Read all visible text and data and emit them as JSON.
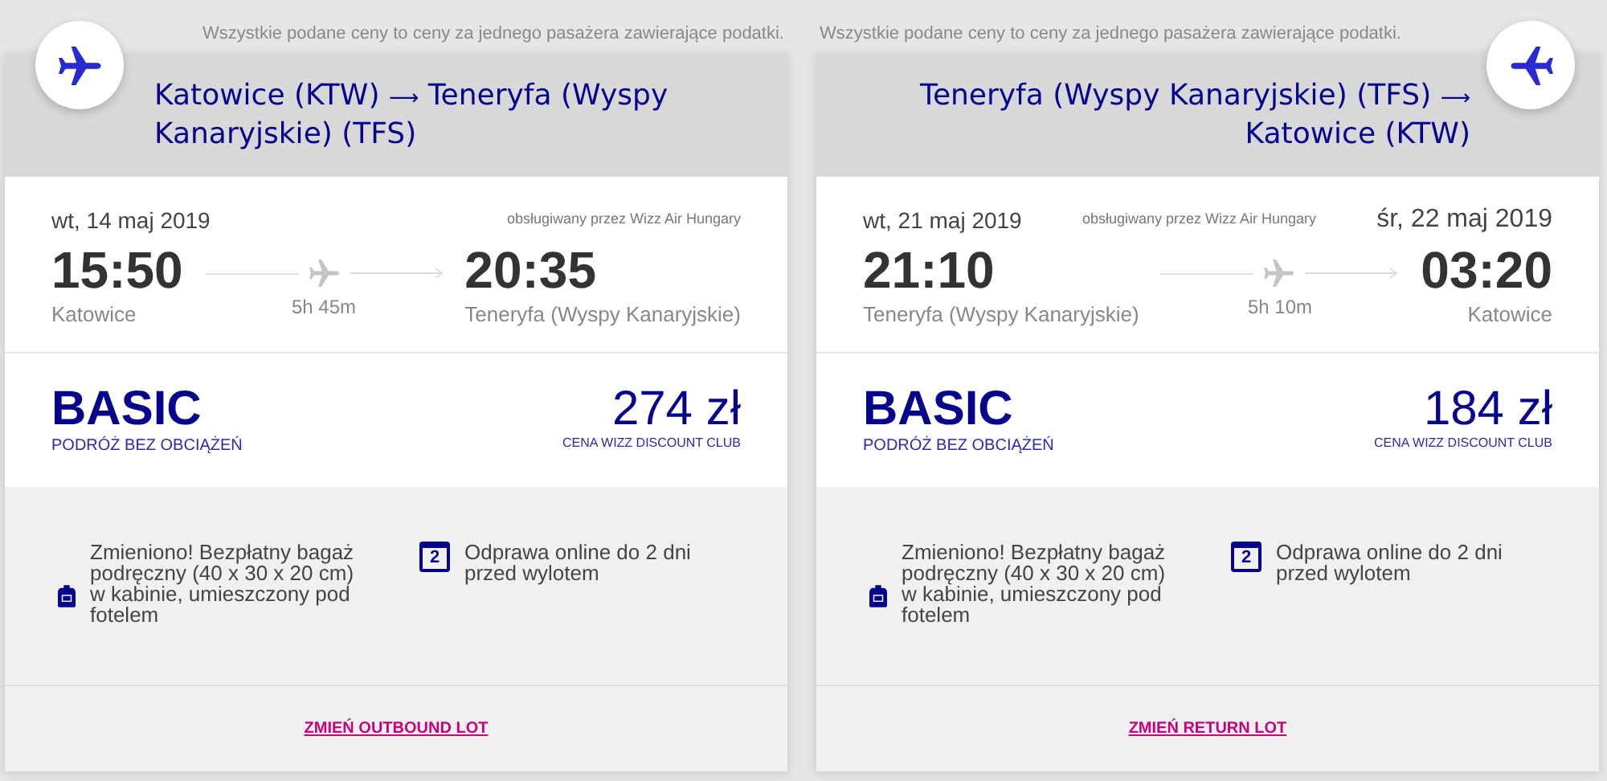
{
  "cards": [
    {
      "kind": "outbound",
      "note": "Wszystkie podane ceny to ceny za jednego pasażera zawierające podatki.",
      "route_from": "Katowice (KTW)",
      "arrow": "⟶",
      "route_to": "Teneryfa (Wyspy Kanaryjskie) (TFS)",
      "departure_date": "wt, 14 maj 2019",
      "operator": "obsługiwany przez Wizz Air Hungary",
      "departure_time": "15:50",
      "departure_city": "Katowice",
      "duration": "5h 45m",
      "arrival_time": "20:35",
      "arrival_city": "Teneryfa (Wyspy Kanaryjskie)",
      "fare": "BASIC",
      "fare_subtitle": "PODRÓŻ BEZ OBCIĄŻEŃ",
      "price": "274 zł",
      "price_label": "CENA WIZZ DISCOUNT CLUB",
      "features": [
        {
          "kind": "bag",
          "text": "Zmieniono! Bezpłatny bagaż podręczny (40 x 30 x 20 cm) w kabinie, umieszczony pod fotelem"
        },
        {
          "kind": "calendar",
          "icon_text": "2",
          "text": "Odprawa online do 2 dni przed wylotem"
        }
      ],
      "change_link": "ZMIEŃ OUTBOUND LOT"
    },
    {
      "kind": "return",
      "note": "Wszystkie podane ceny to ceny za jednego pasażera zawierające podatki.",
      "route_from": "Teneryfa (Wyspy Kanaryjskie) (TFS)",
      "arrow": "⟶",
      "route_to": "Katowice (KTW)",
      "departure_date": "wt, 21 maj 2019",
      "operator": "obsługiwany przez Wizz Air Hungary",
      "arrival_date": "śr, 22 maj 2019",
      "departure_time": "21:10",
      "departure_city": "Teneryfa (Wyspy Kanaryjskie)",
      "duration": "5h 10m",
      "arrival_time": "03:20",
      "arrival_city": "Katowice",
      "fare": "BASIC",
      "fare_subtitle": "PODRÓŻ BEZ OBCIĄŻEŃ",
      "price": "184 zł",
      "price_label": "CENA WIZZ DISCOUNT CLUB",
      "features": [
        {
          "kind": "bag",
          "text": "Zmieniono! Bezpłatny bagaż podręczny (40 x 30 x 20 cm) w kabinie, umieszczony pod fotelem"
        },
        {
          "kind": "calendar",
          "icon_text": "2",
          "text": "Odprawa online do 2 dni przed wylotem"
        }
      ],
      "change_link": "ZMIEŃ RETURN LOT"
    }
  ]
}
